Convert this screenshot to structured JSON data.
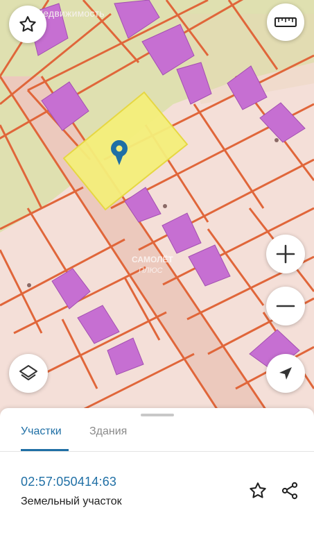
{
  "map": {
    "brand_label": "Недвижимость",
    "watermark_line1": "САМОЛЁТ",
    "watermark_line2": "ПЛЮС"
  },
  "controls": {
    "favorite": "star-icon",
    "ruler": "ruler-icon",
    "zoom_in": "plus-icon",
    "zoom_out": "minus-icon",
    "layers": "layers-icon",
    "locate": "navigation-arrow-icon"
  },
  "sheet": {
    "tabs": [
      {
        "label": "Участки",
        "active": true
      },
      {
        "label": "Здания",
        "active": false
      }
    ],
    "result": {
      "cadastral_number": "02:57:050414:63",
      "object_type": "Земельный участок"
    }
  },
  "colors": {
    "accent": "#1f6fa5",
    "parcel_border": "#e0663a",
    "building": "#c66fd2",
    "selected_parcel": "#f3ee7a",
    "green_zone": "#dfe0b0"
  }
}
